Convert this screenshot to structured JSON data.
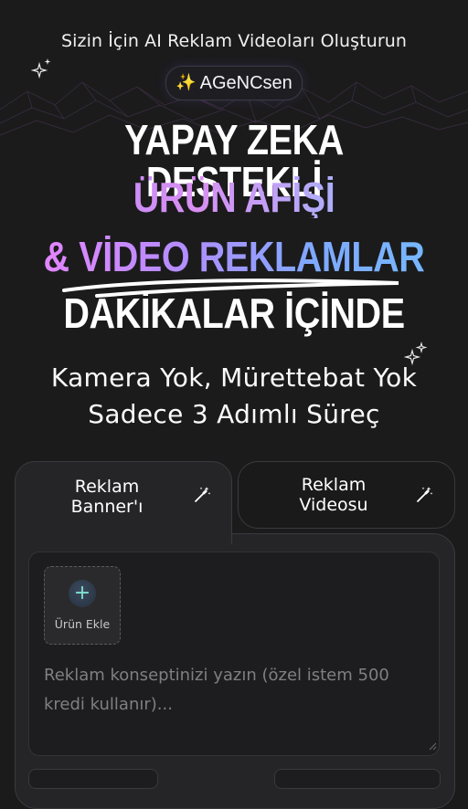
{
  "header": {
    "subtitle": "Sizin İçin AI Reklam Videoları Oluşturun",
    "brand_name": "AGeNCsen"
  },
  "hero": {
    "line1": "YAPAY ZEKA DESTEKLİ",
    "line2": "ÜRÜN AFİŞİ",
    "line3": "& VİDEO REKLAMLAR",
    "line4": "DAKİKALAR İÇİNDE"
  },
  "tagline": {
    "line1": "Kamera Yok, Mürettebat Yok",
    "line2": "Sadece 3 Adımlı Süreç"
  },
  "tabs": [
    {
      "label": "Reklam Banner'ı",
      "active": true
    },
    {
      "label": "Reklam Videosu",
      "active": false
    }
  ],
  "composer": {
    "add_product_label": "Ürün Ekle",
    "placeholder": "Reklam konseptinizi yazın (özel istem 500 kredi kullanır)..."
  },
  "colors": {
    "background": "#1b1b1c",
    "panel": "#252527",
    "accent_purple": "#b88cff",
    "accent_blue": "#7ea9ff"
  }
}
